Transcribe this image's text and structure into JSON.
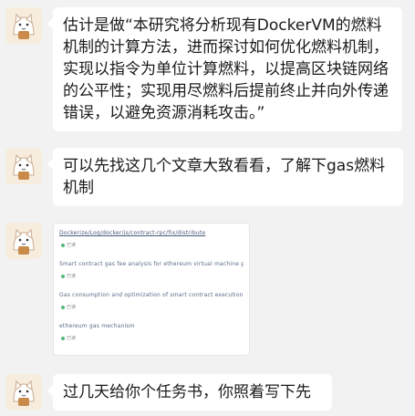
{
  "messages": [
    {
      "type": "text",
      "text": "估计是做“本研究将分析现有DockerVM的燃料\n机制的计算方法，进而探讨如何优化燃料机制，\n实现以指令为单位计算燃料，以提高区块链网络\n的公平性；实现用尽燃料后提前终止并向外传递\n错误，以避免资源消耗攻击。”"
    },
    {
      "type": "text",
      "text": "可以先找这几个文章大致看看，了解下gas燃料\n机制"
    },
    {
      "type": "image",
      "refs": [
        {
          "title": "Dockerize/Log/docker/js/contract-rpc/fix/distribute",
          "meta": "已读"
        },
        {
          "title": "Smart contract gas fee analysis for ethereum virtual machine platform",
          "meta": "已读"
        },
        {
          "title": "Gas consumption and optimization of smart contract executions in blockchains",
          "meta": "已读"
        },
        {
          "title": "ethereum gas mechanism",
          "meta": "已读"
        }
      ]
    },
    {
      "type": "text",
      "text": "过几天给你个任务书，你照着写下先"
    }
  ]
}
